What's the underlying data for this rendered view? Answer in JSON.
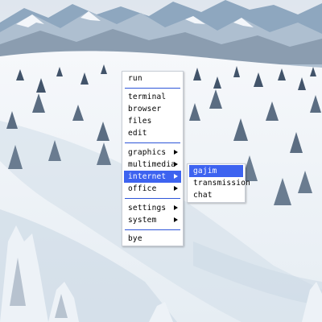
{
  "main_menu": {
    "items": [
      {
        "label": "run"
      },
      {
        "label": "terminal"
      },
      {
        "label": "browser"
      },
      {
        "label": "files"
      },
      {
        "label": "edit"
      },
      {
        "label": "graphics"
      },
      {
        "label": "multimedia"
      },
      {
        "label": "internet"
      },
      {
        "label": "office"
      },
      {
        "label": "settings"
      },
      {
        "label": "system"
      },
      {
        "label": "bye"
      }
    ],
    "selected": "internet"
  },
  "internet_submenu": {
    "items": [
      {
        "label": "gajim"
      },
      {
        "label": "transmission"
      },
      {
        "label": "chat"
      }
    ],
    "selected": "gajim"
  },
  "colors": {
    "highlight": "#3d63f0",
    "separator": "#2e55d8",
    "menu_background": "#ffffff"
  }
}
